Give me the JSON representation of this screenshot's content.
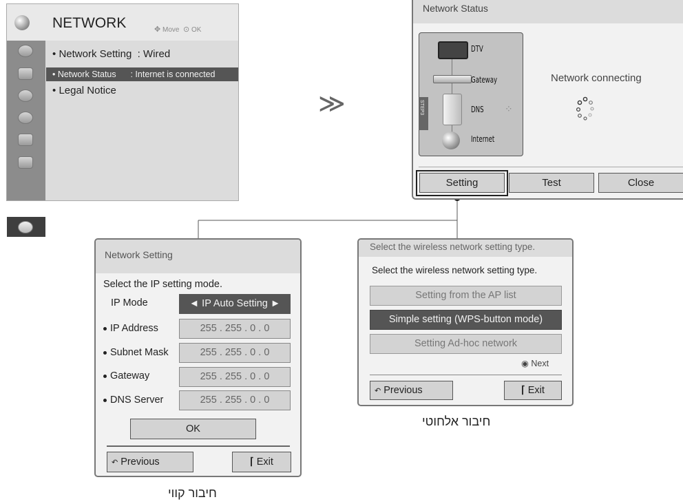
{
  "network_menu": {
    "title": "NETWORK",
    "hint_move": "Move",
    "hint_ok": "OK",
    "items": [
      {
        "bullet": "•",
        "label": "Network Setting",
        "value": ": Wired"
      },
      {
        "bullet": "•",
        "label": "Network Status",
        "value": ": Internet is connected"
      },
      {
        "bullet": "•",
        "label": "Legal Notice",
        "value": ""
      }
    ]
  },
  "arrow_glyph": "≫",
  "network_status": {
    "title": "Network Status",
    "steps": [
      "DTV",
      "Gateway",
      "DNS",
      "Internet"
    ],
    "step_badge": "STEP3",
    "message": "Network connecting",
    "buttons": [
      "Setting",
      "Test",
      "Close"
    ]
  },
  "network_setting": {
    "title": "Network Setting",
    "prompt": "Select the IP setting mode.",
    "ip_mode_label": "IP Mode",
    "ip_mode_value": "◄ IP Auto Setting ►",
    "fields": [
      {
        "label": "IP Address",
        "value": "255 . 255 . 0 . 0"
      },
      {
        "label": "Subnet Mask",
        "value": "255 . 255 . 0 . 0"
      },
      {
        "label": "Gateway",
        "value": "255 . 255 . 0 . 0"
      },
      {
        "label": "DNS Server",
        "value": "255 . 255 . 0 . 0"
      }
    ],
    "ok_label": "OK",
    "previous_label": "Previous",
    "exit_label": "Exit",
    "caption": "חיבור קווי"
  },
  "wireless": {
    "title": "Select the wireless network setting type.",
    "prompt": "Select the wireless network setting type.",
    "options": [
      {
        "label": "Setting from the AP list",
        "selected": false
      },
      {
        "label": "Simple setting (WPS-button mode)",
        "selected": true
      },
      {
        "label": "Setting Ad-hoc network",
        "selected": false
      }
    ],
    "next_label": "Next",
    "previous_label": "Previous",
    "exit_label": "Exit",
    "caption": "חיבור אלחוטי"
  }
}
